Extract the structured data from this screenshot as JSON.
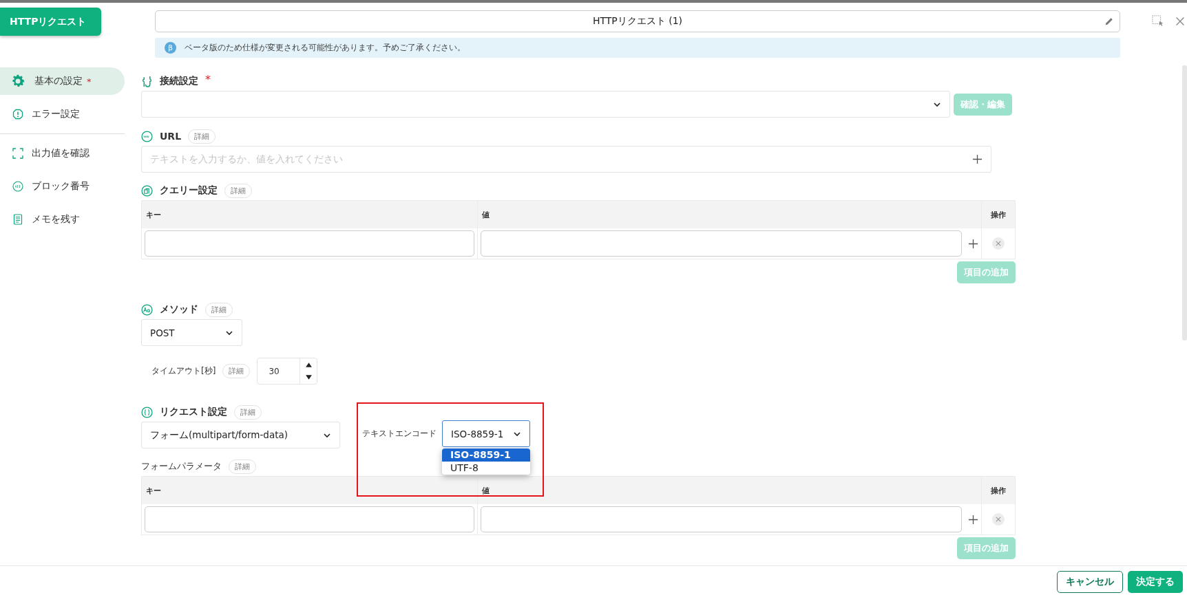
{
  "header_button": "HTTPリクエスト",
  "sidebar": {
    "groups": [
      [
        {
          "label": "基本の設定",
          "required_mark": "*",
          "selected": true
        },
        {
          "label": "エラー設定",
          "selected": false
        }
      ],
      [
        {
          "label": "出力値を確認",
          "selected": false
        },
        {
          "label": "ブロック番号",
          "selected": false
        },
        {
          "label": "メモを残す",
          "selected": false
        }
      ]
    ]
  },
  "title_field": {
    "value": "HTTPリクエスト (1)"
  },
  "beta_notice": {
    "badge": "β",
    "text": "ベータ版のため仕様が変更される可能性があります。予めご了承ください。"
  },
  "connection": {
    "label": "接続設定",
    "required_mark": "*",
    "button": {
      "label": "確認・編集",
      "disabled": true
    }
  },
  "url": {
    "label": "URL",
    "detail": "詳細",
    "placeholder": "テキストを入力するか、値を入れてください"
  },
  "query": {
    "label": "クエリー設定",
    "detail": "詳細",
    "columns": [
      "キー",
      "値",
      "操作"
    ],
    "rows": [
      {
        "deletable": true
      }
    ],
    "add_button": {
      "label": "項目の追加",
      "disabled": true
    }
  },
  "method": {
    "label": "メソッド",
    "detail": "詳細",
    "value": "POST"
  },
  "timeout": {
    "label": "タイムアウト[秒]",
    "detail": "詳細",
    "value": "30"
  },
  "request": {
    "label": "リクエスト設定",
    "detail": "詳細",
    "value": "フォーム(multipart/form-data)"
  },
  "text_encoding": {
    "label": "テキストエンコード",
    "value": "ISO-8859-1",
    "highlighted": true,
    "expanded": true,
    "options": [
      {
        "label": "ISO-8859-1",
        "selected": true
      },
      {
        "label": "UTF-8",
        "selected": false
      }
    ]
  },
  "form_params": {
    "label": "フォームパラメータ",
    "detail": "詳細",
    "columns": [
      "キー",
      "値",
      "操作"
    ],
    "rows": [
      {
        "deletable": true
      }
    ],
    "add_button": {
      "label": "項目の追加",
      "disabled": true
    }
  },
  "footer": {
    "buttons": [
      {
        "label": "キャンセル",
        "kind": "secondary"
      },
      {
        "label": "決定する",
        "kind": "primary"
      }
    ]
  }
}
